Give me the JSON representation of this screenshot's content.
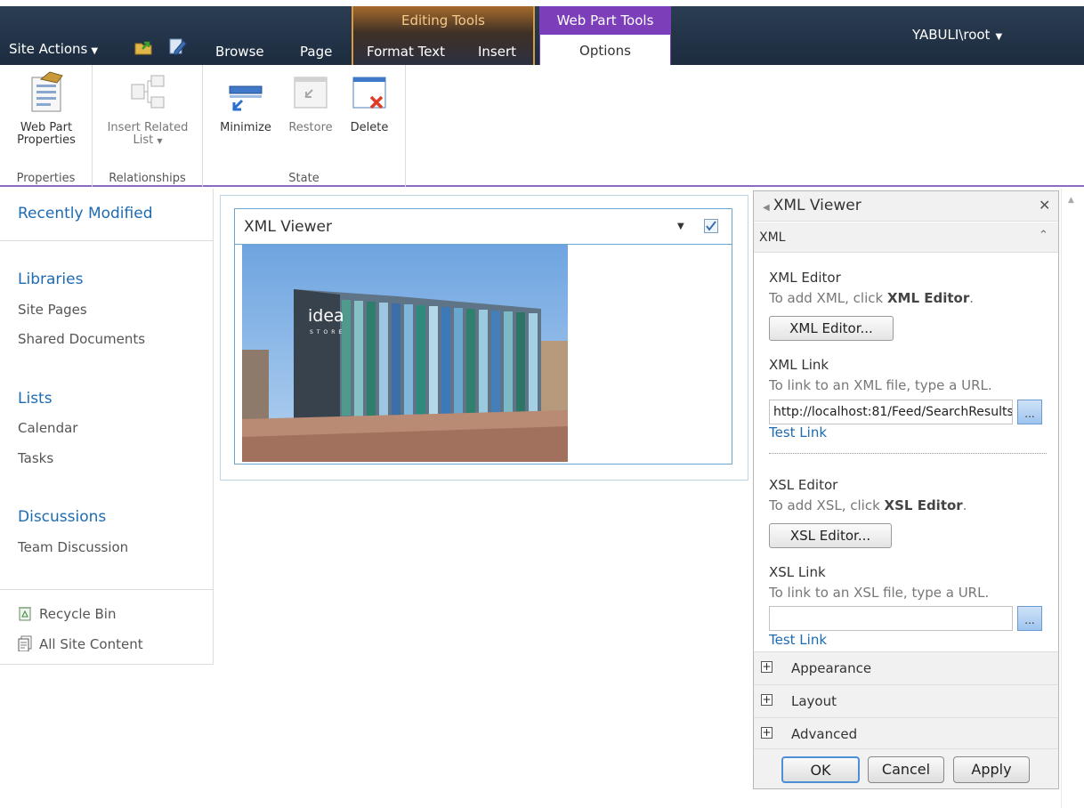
{
  "topbar": {
    "site_actions": "Site Actions",
    "tabs": {
      "browse": "Browse",
      "page": "Page",
      "format_text": "Format Text",
      "insert": "Insert",
      "options": "Options"
    },
    "contextual": {
      "editing_tools": "Editing Tools",
      "web_part_tools": "Web Part Tools"
    },
    "user": "YABULI\\root"
  },
  "ribbon": {
    "groups": {
      "properties": "Properties",
      "relationships": "Relationships",
      "state": "State"
    },
    "buttons": {
      "web_part_properties_1": "Web Part",
      "web_part_properties_2": "Properties",
      "insert_related_1": "Insert Related",
      "insert_related_2": "List",
      "minimize": "Minimize",
      "restore": "Restore",
      "delete": "Delete"
    }
  },
  "leftnav": {
    "recently_modified": "Recently Modified",
    "libraries": "Libraries",
    "site_pages": "Site Pages",
    "shared_documents": "Shared Documents",
    "lists": "Lists",
    "calendar": "Calendar",
    "tasks": "Tasks",
    "discussions": "Discussions",
    "team_discussion": "Team Discussion",
    "recycle_bin": "Recycle Bin",
    "all_site_content": "All Site Content"
  },
  "webpart": {
    "title": "XML Viewer",
    "image_sign_1": "idea",
    "image_sign_2": "STORE"
  },
  "toolpane": {
    "title": "XML Viewer",
    "section": "XML",
    "xml_editor_label": "XML Editor",
    "xml_editor_desc_prefix": "To add XML, click ",
    "xml_editor_desc_bold": "XML Editor",
    "xml_editor_button": "XML Editor...",
    "xml_link_label": "XML Link",
    "xml_link_desc": "To link to an XML file, type a URL.",
    "xml_link_value": "http://localhost:81/Feed/SearchResults",
    "browse_label": "...",
    "test_link": "Test Link",
    "xsl_editor_label": "XSL Editor",
    "xsl_editor_desc_prefix": "To add XSL, click ",
    "xsl_editor_desc_bold": "XSL Editor",
    "xsl_editor_button": "XSL Editor...",
    "xsl_link_label": "XSL Link",
    "xsl_link_desc": "To link to an XSL file, type a URL.",
    "xsl_link_value": "",
    "appearance": "Appearance",
    "layout": "Layout",
    "advanced": "Advanced",
    "ok": "OK",
    "cancel": "Cancel",
    "apply": "Apply"
  }
}
